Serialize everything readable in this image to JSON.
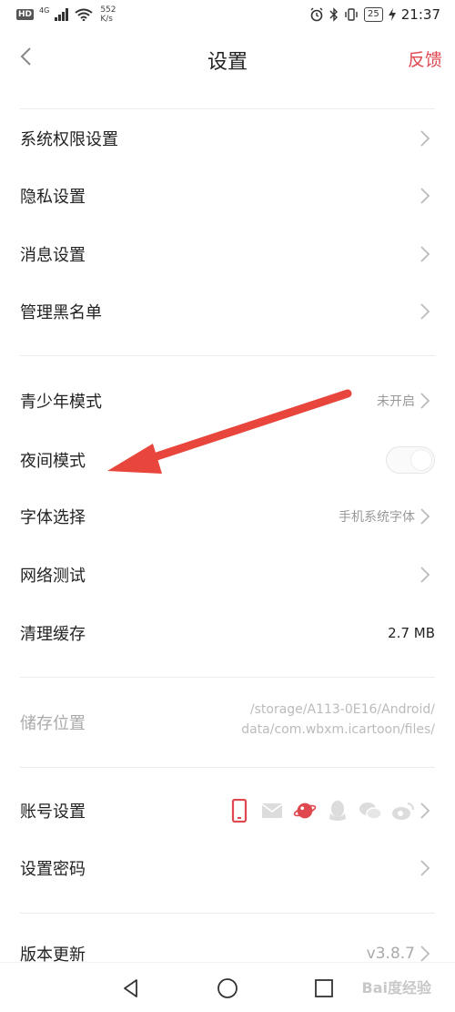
{
  "status_bar": {
    "hd": "HD",
    "signal": "4G",
    "net_speed_value": "552",
    "net_speed_unit": "K/s",
    "battery": "25",
    "time": "21:37"
  },
  "header": {
    "title": "设置",
    "feedback": "反馈"
  },
  "section1": [
    {
      "label": "系统权限设置"
    },
    {
      "label": "隐私设置"
    },
    {
      "label": "消息设置"
    },
    {
      "label": "管理黑名单"
    }
  ],
  "section2": {
    "youth_mode": {
      "label": "青少年模式",
      "value": "未开启"
    },
    "night_mode": {
      "label": "夜间模式",
      "enabled": false
    },
    "font_select": {
      "label": "字体选择",
      "value": "手机系统字体"
    },
    "network_test": {
      "label": "网络测试"
    },
    "clear_cache": {
      "label": "清理缓存",
      "value": "2.7 MB"
    }
  },
  "storage": {
    "label": "储存位置",
    "path_line1": "/storage/A113-0E16/Android/",
    "path_line2": "data/com.wbxm.icartoon/files/"
  },
  "section3": {
    "account": {
      "label": "账号设置",
      "icons": [
        "phone-icon",
        "mail-icon",
        "planet-icon",
        "qq-icon",
        "wechat-icon",
        "weibo-icon"
      ]
    },
    "password": {
      "label": "设置密码"
    },
    "version": {
      "label": "版本更新",
      "value": "v3.8.7"
    }
  },
  "watermark": "Bai度经验",
  "colors": {
    "accent": "#e04850",
    "arrow": "#e8453c"
  }
}
